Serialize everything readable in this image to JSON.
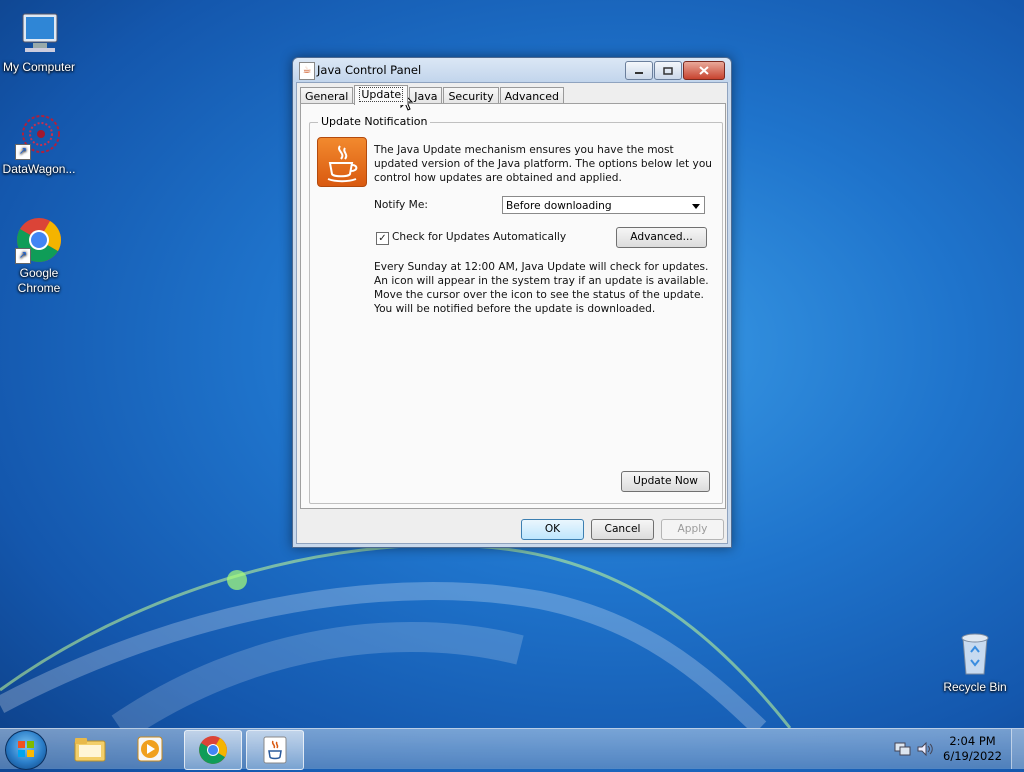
{
  "desktop": {
    "icons": [
      {
        "label": "My Computer"
      },
      {
        "label": "DataWagon..."
      },
      {
        "label": "Google Chrome"
      },
      {
        "label": "Recycle Bin"
      }
    ]
  },
  "window": {
    "title": "Java Control Panel",
    "tabs": [
      {
        "label": "General",
        "active": false
      },
      {
        "label": "Update",
        "active": true
      },
      {
        "label": "Java",
        "active": false
      },
      {
        "label": "Security",
        "active": false
      },
      {
        "label": "Advanced",
        "active": false
      }
    ],
    "group_title": "Update Notification",
    "description": "The Java Update mechanism ensures you have the most updated version of the Java platform.  The options below let you control how updates are obtained and applied.",
    "notify_label": "Notify Me:",
    "notify_value": "Before downloading",
    "check_label": "Check for Updates Automatically",
    "check_checked": true,
    "advanced_button": "Advanced...",
    "schedule_text": "Every Sunday at 12:00 AM, Java Update will check for updates. An icon will appear in the system tray if an update is available. Move the cursor over the icon to see the status of the update. You will be notified before the update is downloaded.",
    "update_now_button": "Update Now",
    "ok_button": "OK",
    "cancel_button": "Cancel",
    "apply_button": "Apply"
  },
  "taskbar": {
    "time": "2:04 PM",
    "date": "6/19/2022"
  }
}
